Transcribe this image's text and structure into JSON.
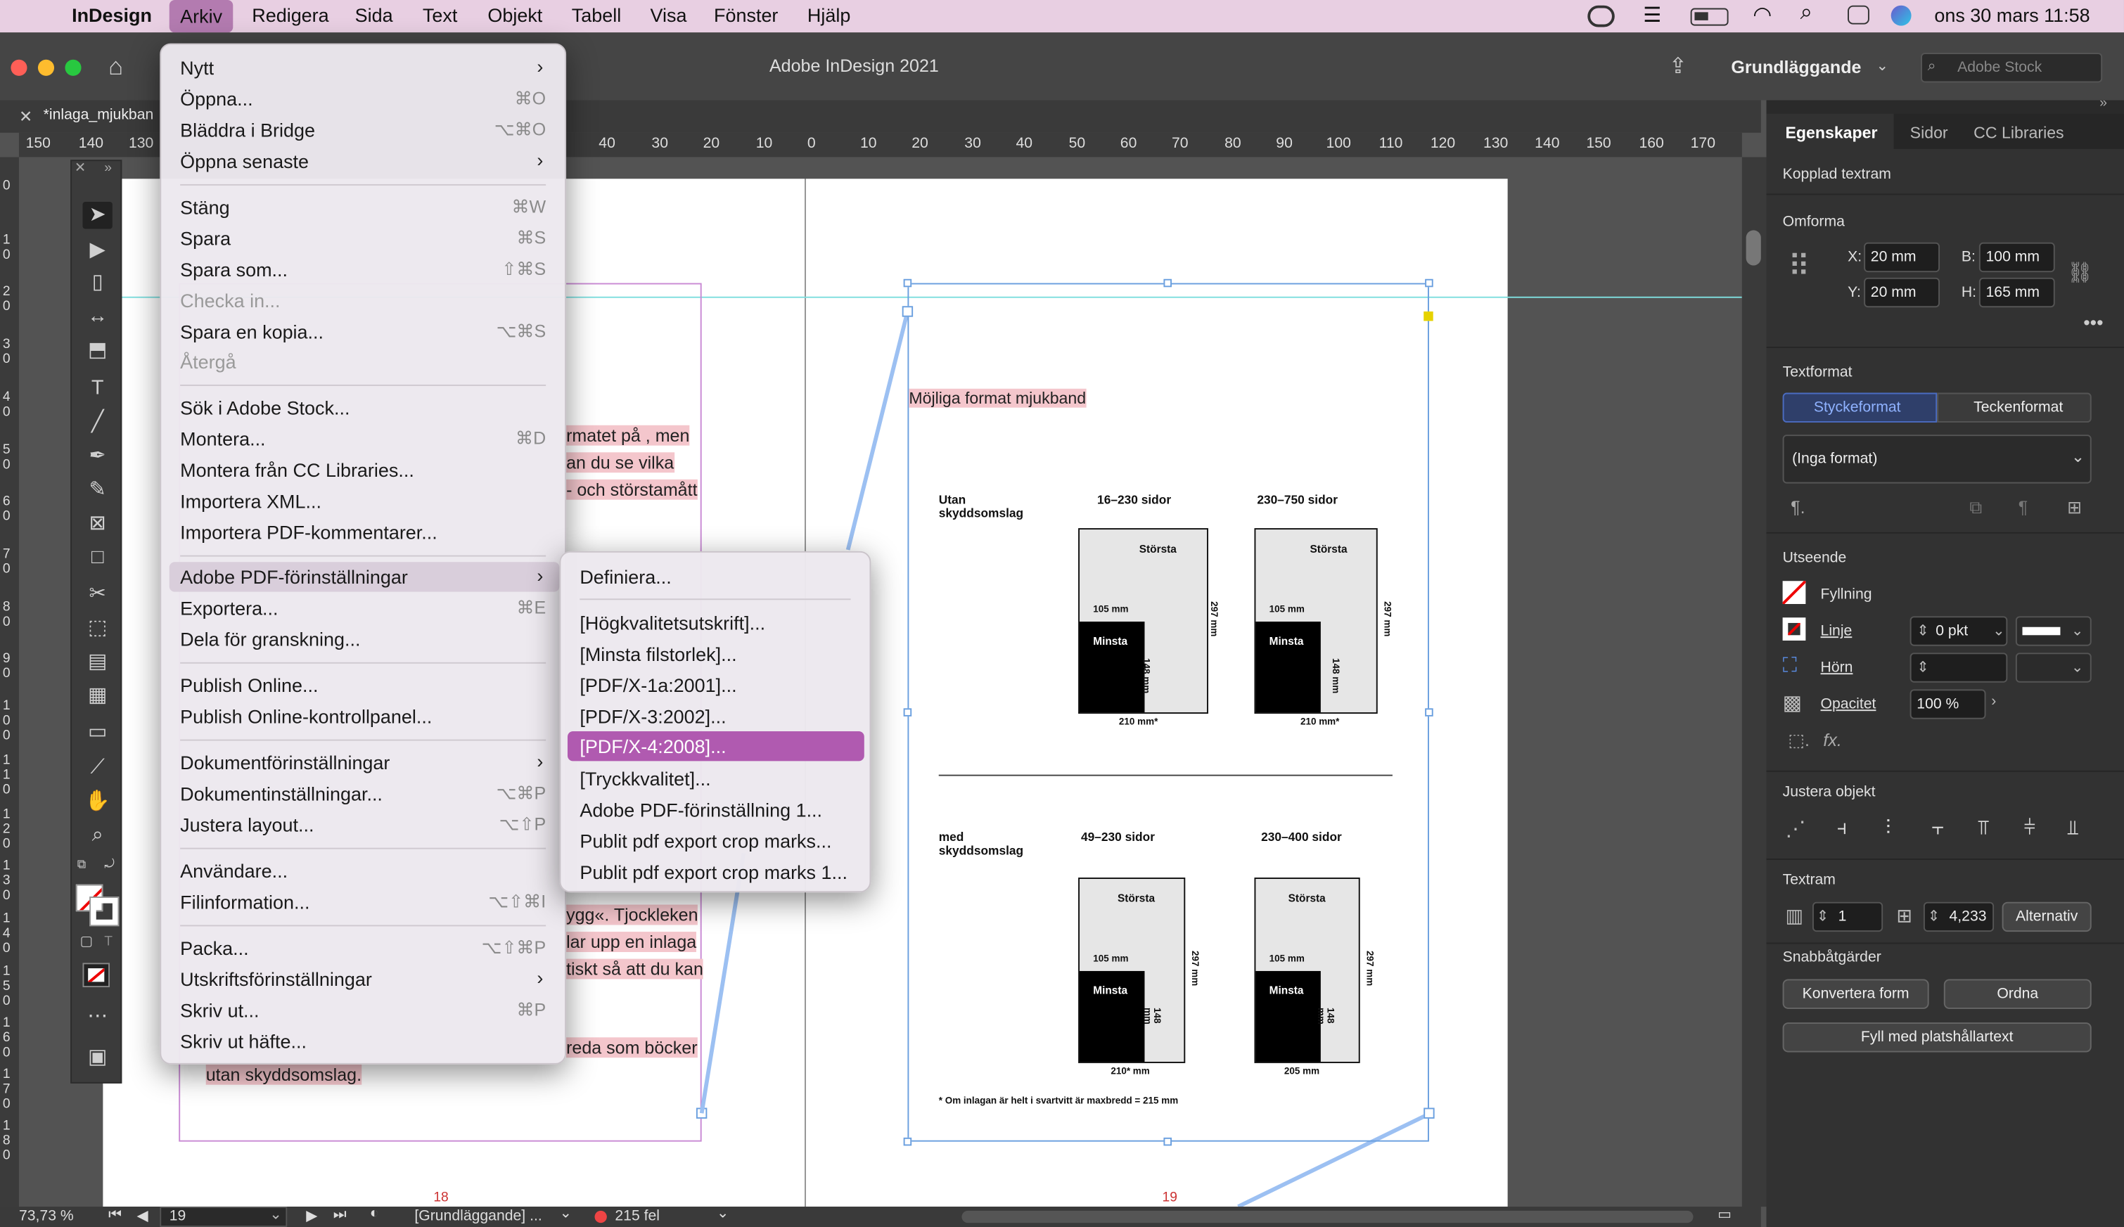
{
  "menubar": {
    "app": "InDesign",
    "items": [
      "Arkiv",
      "Redigera",
      "Sida",
      "Text",
      "Objekt",
      "Tabell",
      "Visa",
      "Fönster",
      "Hjälp"
    ],
    "datetime": "ons 30 mars  11:58"
  },
  "window": {
    "title": "Adobe InDesign 2021",
    "workspace": "Grundläggande",
    "search_placeholder": "Adobe Stock",
    "doc_tab": "*inlaga_mjukban"
  },
  "ruler": {
    "ticks": [
      "150",
      "140",
      "130",
      "40",
      "30",
      "20",
      "10",
      "0",
      "10",
      "20",
      "30",
      "40",
      "50",
      "60",
      "70",
      "80",
      "90",
      "100",
      "110",
      "120",
      "130",
      "140",
      "150",
      "160",
      "170"
    ],
    "vticks": [
      "0",
      "1 0",
      "2 0",
      "3 0",
      "4 0",
      "5 0",
      "6 0",
      "7 0",
      "8 0",
      "9 0",
      "1 0 0",
      "1 1 0",
      "1 2 0",
      "1 3 0",
      "1 4 0",
      "1 5 0",
      "1 6 0",
      "1 7 0",
      "1 8 0"
    ]
  },
  "arkiv_menu": {
    "items": [
      {
        "label": "Nytt",
        "shortcut": "",
        "sub": true
      },
      {
        "label": "Öppna...",
        "shortcut": "⌘O"
      },
      {
        "label": "Bläddra i Bridge",
        "shortcut": "⌥⌘O"
      },
      {
        "label": "Öppna senaste",
        "sub": true
      },
      {
        "label": "Stäng",
        "shortcut": "⌘W"
      },
      {
        "label": "Spara",
        "shortcut": "⌘S"
      },
      {
        "label": "Spara som...",
        "shortcut": "⇧⌘S"
      },
      {
        "label": "Checka in...",
        "disabled": true
      },
      {
        "label": "Spara en kopia...",
        "shortcut": "⌥⌘S"
      },
      {
        "label": "Återgå",
        "disabled": true
      },
      {
        "label": "Sök i Adobe Stock..."
      },
      {
        "label": "Montera...",
        "shortcut": "⌘D"
      },
      {
        "label": "Montera från CC Libraries..."
      },
      {
        "label": "Importera XML..."
      },
      {
        "label": "Importera PDF-kommentarer..."
      },
      {
        "label": "Adobe PDF-förinställningar",
        "sub": true
      },
      {
        "label": "Exportera...",
        "shortcut": "⌘E"
      },
      {
        "label": "Dela för granskning..."
      },
      {
        "label": "Publish Online..."
      },
      {
        "label": "Publish Online-kontrollpanel..."
      },
      {
        "label": "Dokumentförinställningar",
        "sub": true
      },
      {
        "label": "Dokumentinställningar...",
        "shortcut": "⌥⌘P"
      },
      {
        "label": "Justera layout...",
        "shortcut": "⌥⇧P"
      },
      {
        "label": "Användare..."
      },
      {
        "label": "Filinformation...",
        "shortcut": "⌥⇧⌘I"
      },
      {
        "label": "Packa...",
        "shortcut": "⌥⇧⌘P"
      },
      {
        "label": "Utskriftsförinställningar",
        "sub": true
      },
      {
        "label": "Skriv ut...",
        "shortcut": "⌘P"
      },
      {
        "label": "Skriv ut häfte..."
      }
    ]
  },
  "pdf_submenu": {
    "items": [
      "Definiera...",
      "[Högkvalitetsutskrift]...",
      "[Minsta filstorlek]...",
      "[PDF/X-1a:2001]...",
      "[PDF/X-3:2002]...",
      "[PDF/X-4:2008]...",
      "[Tryckkvalitet]...",
      "Adobe PDF-förinställning 1...",
      "Publit pdf export crop marks...",
      "Publit pdf export crop marks 1..."
    ],
    "selected": "[PDF/X-4:2008]..."
  },
  "left_page": {
    "lines": [
      "rmatet på , men",
      "an du se vilka",
      "- och störstamått",
      "ygg«. Tjockleken",
      "lar upp en inlaga",
      "tiskt så att du kan",
      "reda som böcker",
      "utan skyddsomslag."
    ],
    "page_number": "18"
  },
  "right_page": {
    "heading": "Möjliga format mjukband",
    "page_number": "19",
    "row1": {
      "label": "Utan skyddsomslag",
      "a": "16–230 sidor",
      "b": "230–750 sidor"
    },
    "row2": {
      "label": "med skyddsomslag",
      "a": "49–230 sidor",
      "b": "230–400 sidor"
    },
    "largest": "Största",
    "smallest": "Minsta",
    "w105": "105 mm",
    "h148": "148 mm",
    "h297": "297 mm",
    "w210s": "210 mm*",
    "w210b": "210* mm",
    "w205": "205 mm",
    "footnote": "* Om inlagan är helt i svartvitt är maxbredd = 215 mm"
  },
  "panel": {
    "tabs": [
      "Egenskaper",
      "Sidor",
      "CC Libraries"
    ],
    "selection": "Kopplad textram",
    "transform": "Omforma",
    "x": "20 mm",
    "y": "20 mm",
    "w": "100 mm",
    "h": "165 mm",
    "textformat": "Textformat",
    "para_tab": "Styckeformat",
    "char_tab": "Teckenformat",
    "style": "(Inga format)",
    "appearance": "Utseende",
    "fill": "Fyllning",
    "stroke": "Linje",
    "stroke_val": "0 pkt",
    "corner": "Hörn",
    "opacity": "Opacitet",
    "opacity_val": "100 %",
    "align": "Justera objekt",
    "textframe": "Textram",
    "cols": "1",
    "gutter": "4,233",
    "options": "Alternativ",
    "quick": "Snabbåtgärder",
    "convert": "Konvertera form",
    "arrange": "Ordna",
    "fill_placeholder": "Fyll med platshållartext"
  },
  "status": {
    "zoom": "73,73 %",
    "page": "19",
    "workspace": "[Grundläggande] ...",
    "errors": "215 fel"
  },
  "colors": {
    "menubar": "#e8cfe2",
    "highlight": "#b05ab0",
    "panel": "#323232",
    "pink": "#f4c6cc"
  }
}
